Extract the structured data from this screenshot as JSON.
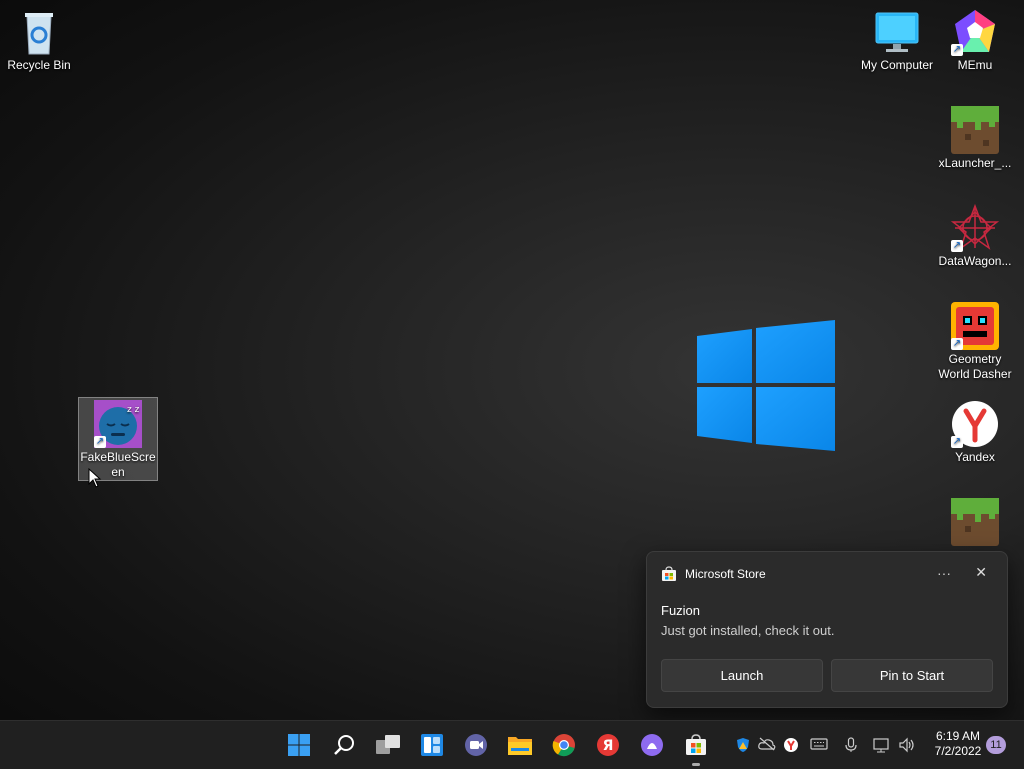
{
  "desktop": {
    "icons": {
      "recycle_bin": "Recycle Bin",
      "my_computer": "My Computer",
      "memu": "MEmu",
      "xlauncher": "xLauncher_...",
      "datawagon": "DataWagon...",
      "geometry": "Geometry World Dasher",
      "yandex": "Yandex",
      "fakebluescreen": "FakeBlueScre en"
    }
  },
  "toast": {
    "app": "Microsoft Store",
    "more": "···",
    "close": "✕",
    "title": "Fuzion",
    "message": "Just got installed, check it out.",
    "launch": "Launch",
    "pin": "Pin to Start"
  },
  "taskbar": {
    "time": "6:19 AM",
    "date": "7/2/2022",
    "notification_count": "11"
  },
  "colors": {
    "accent": "#0078d4",
    "toast_bg": "#2b2b2b",
    "taskbar_bg": "#202020"
  }
}
